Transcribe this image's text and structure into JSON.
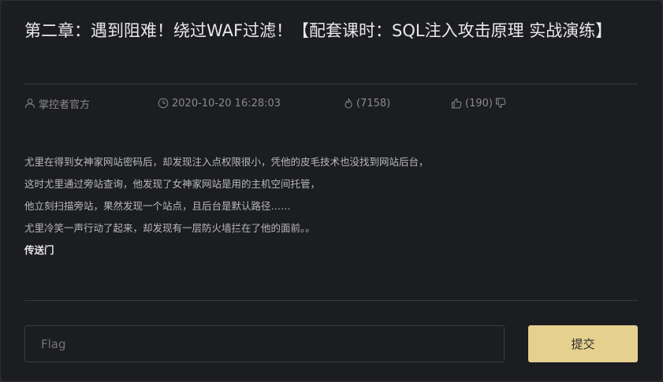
{
  "challenge": {
    "title": "第二章：遇到阻难！绕过WAF过滤！【配套课时：SQL注入攻击原理 实战演练】",
    "author": "掌控者官方",
    "datetime": "2020-10-20 16:28:03",
    "heat": "(7158)",
    "likes": "(190)",
    "description": [
      "尤里在得到女神家网站密码后，却发现注入点权限很小，凭他的皮毛技术也没找到网站后台，",
      "这时尤里通过旁站查询，他发现了女神家网站是用的主机空间托管，",
      "他立刻扫描旁站，果然发现一个站点，且后台是默认路径……",
      "尤里冷笑一声行动了起来，却发现有一层防火墙拦在了他的面前。。"
    ],
    "link_label": "传送门"
  },
  "form": {
    "flag_placeholder": "Flag",
    "flag_value": "",
    "submit_label": "提交"
  },
  "colors": {
    "background": "#1c1d21",
    "accent": "#e6d08f"
  }
}
